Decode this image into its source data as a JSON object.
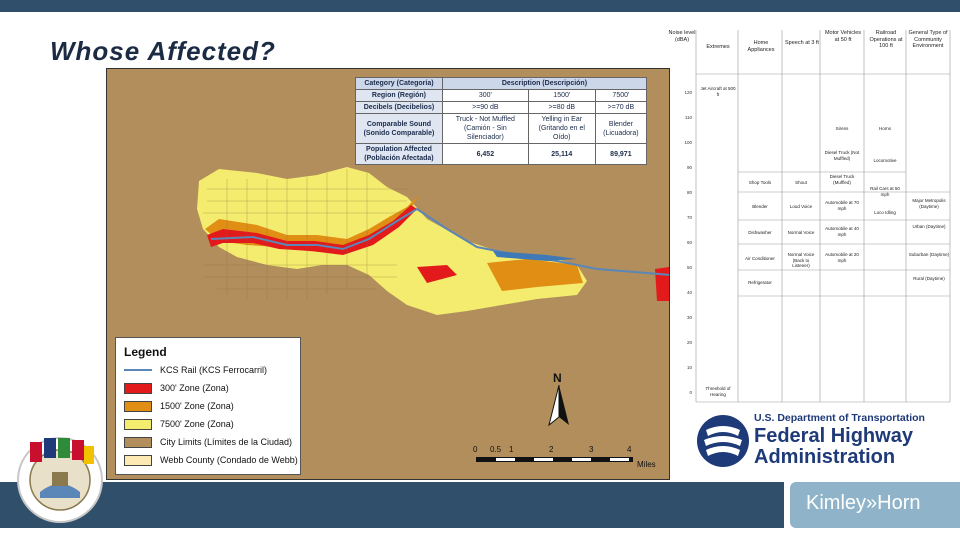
{
  "slide": {
    "title": "Whose Affected?"
  },
  "colors": {
    "bar": "#2f4f6b",
    "zone300": "#e31a1c",
    "zone1500": "#e08e14",
    "zone7500": "#f4ec6e",
    "city_limits": "#b18e5c",
    "webb_county": "#fce9b4",
    "rail": "#5a86b8",
    "dot_blue": "#1f3a78"
  },
  "table": {
    "headers": [
      "Category (Categoría)",
      "Description (Descripción)"
    ],
    "rows": [
      {
        "label": "Region (Región)",
        "values": [
          "300'",
          "1500'",
          "7500'"
        ]
      },
      {
        "label": "Decibels (Decibelios)",
        "values": [
          ">=90 dB",
          ">=80 dB",
          ">=70 dB"
        ]
      },
      {
        "label": "Comparable Sound (Sonido Comparable)",
        "values": [
          "Truck - Not Muffled (Camión - Sin Silenciador)",
          "Yelling in Ear (Gritando en el Oído)",
          "Blender (Licuadora)"
        ]
      },
      {
        "label": "Population Affected (Población Afectada)",
        "values": [
          "6,452",
          "25,114",
          "89,971"
        ]
      }
    ]
  },
  "legend": {
    "title": "Legend",
    "items": [
      {
        "label": "KCS Rail (KCS Ferrocarril)",
        "kind": "line",
        "color": "#5a86b8"
      },
      {
        "label": "300' Zone (Zona)",
        "kind": "fill",
        "color": "#e31a1c"
      },
      {
        "label": "1500' Zone (Zona)",
        "kind": "fill",
        "color": "#e08e14"
      },
      {
        "label": "7500' Zone (Zona)",
        "kind": "fill",
        "color": "#f4ec6e"
      },
      {
        "label": "City Limits (Límites de la Ciudad)",
        "kind": "fill",
        "color": "#b18e5c"
      },
      {
        "label": "Webb County (Condado de Webb)",
        "kind": "fill",
        "color": "#fce9b4"
      }
    ]
  },
  "north_arrow": {
    "label": "N"
  },
  "scale": {
    "ticks": [
      "0",
      "0.5",
      "1",
      "2",
      "3",
      "4"
    ],
    "unit": "Miles"
  },
  "noise_chart": {
    "headers": [
      "Noise level (dBA)",
      "Extremes",
      "Home Appliances",
      "Speech at 3 ft",
      "Motor Vehicles at 50 ft",
      "Railroad Operations at 100 ft",
      "General Type of Community Environment"
    ],
    "y_ticks": [
      "120",
      "110",
      "100",
      "90",
      "80",
      "70",
      "60",
      "50",
      "40",
      "30",
      "20",
      "10",
      "0"
    ],
    "entries": {
      "extremes": [
        "Jet Aircraft at 500 ft",
        "Threshold of Hearing"
      ],
      "appliances": [
        "Shop Tools",
        "Blender",
        "Dishwasher",
        "Air Conditioner",
        "Refrigerator"
      ],
      "speech": [
        "Shout",
        "Loud Voice",
        "Normal Voice",
        "Normal Voice (Back to Listener)"
      ],
      "vehicles": [
        "Sirens",
        "Diesel Truck (Not Muffled)",
        "Diesel Truck (Muffled)",
        "Automobile at 70 mph",
        "Automobile at 40 mph",
        "Automobile at 20 mph"
      ],
      "railroad": [
        "Horns",
        "Locomotive",
        "Rail Cars at 50 mph",
        "Loco Idling"
      ],
      "community": [
        "Major Metropolis (Daytime)",
        "Urban (Daytime)",
        "Suburban (Daytime)",
        "Rural (Daytime)"
      ]
    }
  },
  "dot_logo": {
    "line1": "U.S. Department of Transportation",
    "line2": "Federal Highway",
    "line3": "Administration"
  },
  "footer": {
    "brand": "Kimley»Horn"
  }
}
